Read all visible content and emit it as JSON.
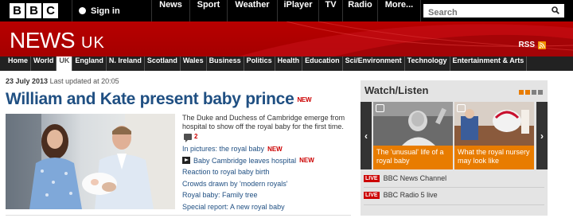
{
  "topbar": {
    "logo_letters": [
      "B",
      "B",
      "C"
    ],
    "signin_label": "Sign in",
    "nav": [
      "News",
      "Sport",
      "Weather",
      "iPlayer",
      "TV",
      "Radio",
      "More..."
    ],
    "search_placeholder": "Search"
  },
  "masthead": {
    "title": "NEWS",
    "edition": "UK",
    "rss_label": "RSS"
  },
  "sections": [
    "Home",
    "World",
    "UK",
    "England",
    "N. Ireland",
    "Scotland",
    "Wales",
    "Business",
    "Politics",
    "Health",
    "Education",
    "Sci/Environment",
    "Technology",
    "Entertainment & Arts"
  ],
  "active_section": "UK",
  "story": {
    "date": "23 July 2013",
    "updated": "Last updated at 20:05",
    "headline": "William and Kate present baby prince",
    "new_tag": "NEW",
    "summary": "The Duke and Duchess of Cambridge emerge from hospital to show off the royal baby for the first time.",
    "comment_count": "2",
    "related": [
      {
        "text": "In pictures: the royal baby",
        "tag": "NEW",
        "video": false
      },
      {
        "text": "Baby Cambridge leaves hospital",
        "tag": "NEW",
        "video": true
      },
      {
        "text": "Reaction to royal baby birth",
        "tag": "",
        "video": false
      },
      {
        "text": "Crowds drawn by 'modern royals'",
        "tag": "",
        "video": false
      },
      {
        "text": "Royal baby: Family tree",
        "tag": "",
        "video": false
      },
      {
        "text": "Special report: A new royal baby",
        "tag": "",
        "video": false
      }
    ]
  },
  "watch": {
    "title": "Watch/Listen",
    "cards": [
      {
        "caption": "The 'unusual' life of a royal baby"
      },
      {
        "caption": "What the royal nursery may look like"
      }
    ],
    "live": [
      {
        "badge": "LIVE",
        "label": "BBC News Channel"
      },
      {
        "badge": "LIVE",
        "label": "BBC Radio 5 live"
      }
    ]
  },
  "colors": {
    "brand_red": "#b80000",
    "headline_blue": "#1f4f82",
    "accent_orange": "#e87c00",
    "live_red": "#cc0000"
  }
}
